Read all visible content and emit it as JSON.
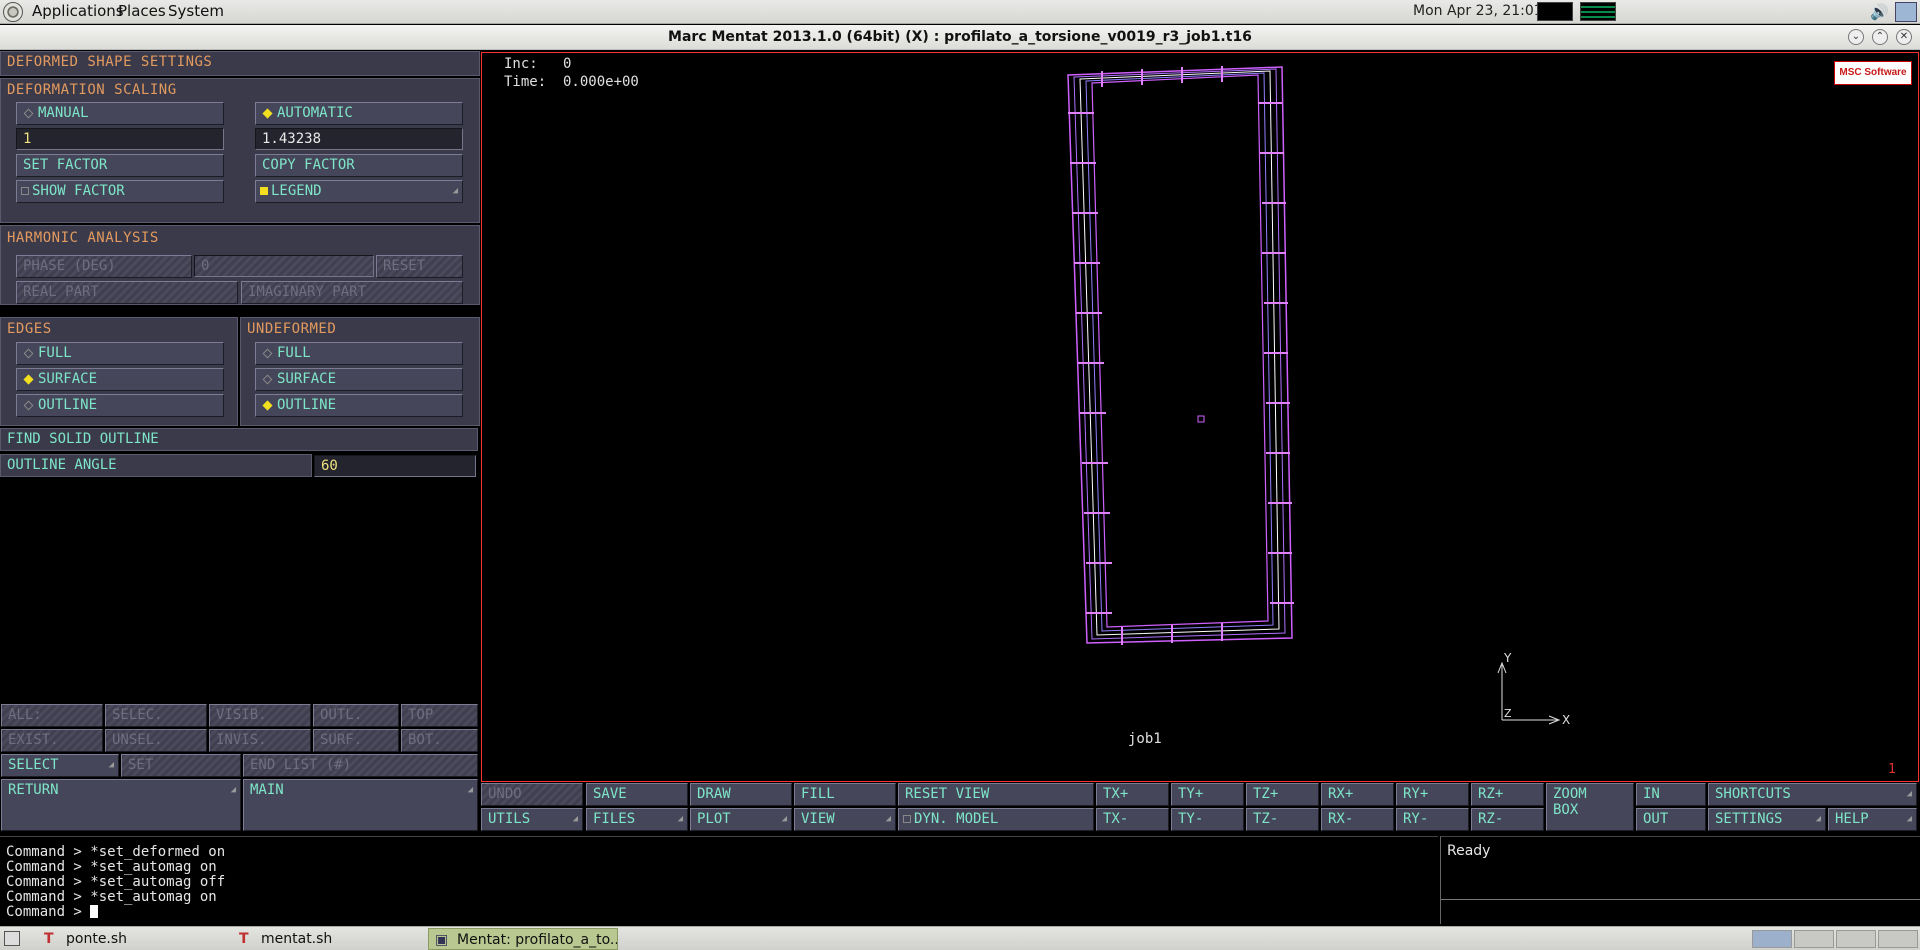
{
  "top_panel": {
    "menus": [
      "Applications",
      "Places",
      "System"
    ],
    "clock": "Mon Apr 23, 21:01"
  },
  "window": {
    "title": "Marc Mentat 2013.1.0 (64bit) (X) : profilato_a_torsione_v0019_r3_job1.t16"
  },
  "left_panel": {
    "title": "DEFORMED SHAPE SETTINGS",
    "scaling": {
      "header": "DEFORMATION SCALING",
      "manual": "MANUAL",
      "automatic": "AUTOMATIC",
      "manual_value": "1",
      "auto_value": "1.43238",
      "set_factor": "SET FACTOR",
      "copy_factor": "COPY FACTOR",
      "show_factor": "SHOW FACTOR",
      "legend": "LEGEND"
    },
    "harmonic": {
      "header": "HARMONIC ANALYSIS",
      "phase": "PHASE (DEG)",
      "phase_value": "0",
      "reset": "RESET",
      "real": "REAL PART",
      "imaginary": "IMAGINARY PART"
    },
    "edges": {
      "header": "EDGES",
      "full": "FULL",
      "surface": "SURFACE",
      "outline": "OUTLINE"
    },
    "undeformed": {
      "header": "UNDEFORMED",
      "full": "FULL",
      "surface": "SURFACE",
      "outline": "OUTLINE"
    },
    "find_solid_outline": "FIND SOLID OUTLINE",
    "outline_angle": "OUTLINE ANGLE",
    "outline_angle_value": "60",
    "select_bar": {
      "all": "ALL:",
      "selec": "SELEC.",
      "visib": "VISIB.",
      "outl": "OUTL.",
      "top": "TOP",
      "exist": "EXIST.",
      "unsel": "UNSEL.",
      "invis": "INVIS.",
      "surf": "SURF.",
      "bot": "BOT.",
      "select": "SELECT",
      "set": "SET",
      "end_list": "END LIST (#)",
      "return": "RETURN",
      "main": "MAIN"
    }
  },
  "viewport": {
    "inc_label": "Inc:   0",
    "time_label": "Time:  0.000e+00",
    "logo": "MSC Software",
    "job_label": "job1",
    "corner_number": "1",
    "axis_y": "Y",
    "axis_x": "X",
    "axis_z": "Z"
  },
  "toolbar": {
    "undo": "UNDO",
    "save": "SAVE",
    "draw": "DRAW",
    "fill": "FILL",
    "reset_view": "RESET VIEW",
    "tx_plus": "TX+",
    "ty_plus": "TY+",
    "tz_plus": "TZ+",
    "rx_plus": "RX+",
    "ry_plus": "RY+",
    "rz_plus": "RZ+",
    "zoom": "ZOOM",
    "box": "BOX",
    "in": "IN",
    "shortcuts": "SHORTCUTS",
    "utils": "UTILS",
    "files": "FILES",
    "plot": "PLOT",
    "view": "VIEW",
    "dyn_model": "DYN. MODEL",
    "tx_minus": "TX-",
    "ty_minus": "TY-",
    "tz_minus": "TZ-",
    "rx_minus": "RX-",
    "ry_minus": "RY-",
    "rz_minus": "RZ-",
    "out": "OUT",
    "settings": "SETTINGS",
    "help": "HELP"
  },
  "command_area": {
    "lines": [
      "Command > *set_deformed on",
      "Command > *set_automag on",
      "Command > *set_automag off",
      "Command > *set_automag on"
    ],
    "prompt": "Command > "
  },
  "status": {
    "text": "Ready"
  },
  "taskbar": {
    "tasks": [
      "ponte.sh",
      "mentat.sh",
      "Mentat: profilato_a_to..."
    ]
  },
  "colors": {
    "label_cyan": "#7ee6c8",
    "header_orange": "#e39a5e",
    "indicator_yellow": "#f2e020",
    "model_magenta": "#d060ff",
    "viewport_border": "#ff3030"
  }
}
